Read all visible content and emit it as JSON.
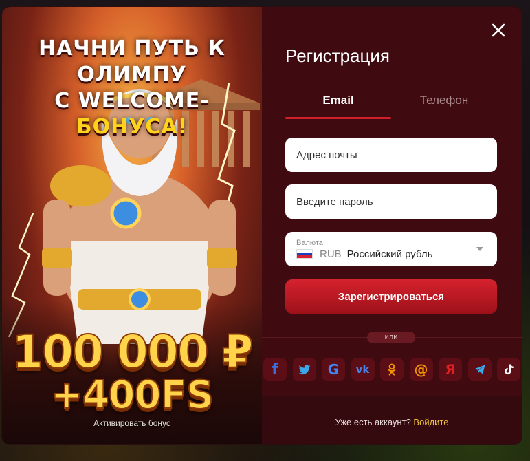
{
  "promo": {
    "headline_line1": "НАЧНИ ПУТЬ К ОЛИМПУ",
    "headline_line2_prefix": "С WELCOME-",
    "headline_line2_accent": "БОНУСА!",
    "amount_line1": "100 000 ₽",
    "amount_line2": "+400FS",
    "activate_label": "Активировать бонус"
  },
  "form": {
    "title": "Регистрация",
    "tabs": [
      {
        "label": "Email",
        "active": true
      },
      {
        "label": "Телефон",
        "active": false
      }
    ],
    "email_placeholder": "Адрес почты",
    "password_placeholder": "Введите пароль",
    "currency": {
      "label": "Валюта",
      "code": "RUB",
      "name": "Российский рубль",
      "flag_colors": [
        "#ffffff",
        "#1c3fbf",
        "#d5222e"
      ]
    },
    "submit_label": "Зарегистрироваться",
    "or_label": "или",
    "socials": [
      {
        "name": "facebook",
        "glyph": "f",
        "color": "#3b6fe0"
      },
      {
        "name": "twitter",
        "glyph": "",
        "color": "#3aa7ea"
      },
      {
        "name": "google",
        "glyph": "G",
        "color": "#4285f4"
      },
      {
        "name": "vk",
        "glyph": "vk",
        "color": "#4a80e0"
      },
      {
        "name": "odnoklassniki",
        "glyph": "ok",
        "color": "#f29300"
      },
      {
        "name": "mailru",
        "glyph": "@",
        "color": "#f29300"
      },
      {
        "name": "yandex",
        "glyph": "Я",
        "color": "#e02020"
      },
      {
        "name": "telegram",
        "glyph": "",
        "color": "#3aa7ea"
      },
      {
        "name": "tiktok",
        "glyph": "♪",
        "color": "#ffffff"
      }
    ],
    "footer_question": "Уже есть аккаунт?",
    "footer_link": "Войдите"
  },
  "colors": {
    "panel_bg": "#3f0b10",
    "accent_red": "#d5222e",
    "link_gold": "#f0c23c"
  }
}
